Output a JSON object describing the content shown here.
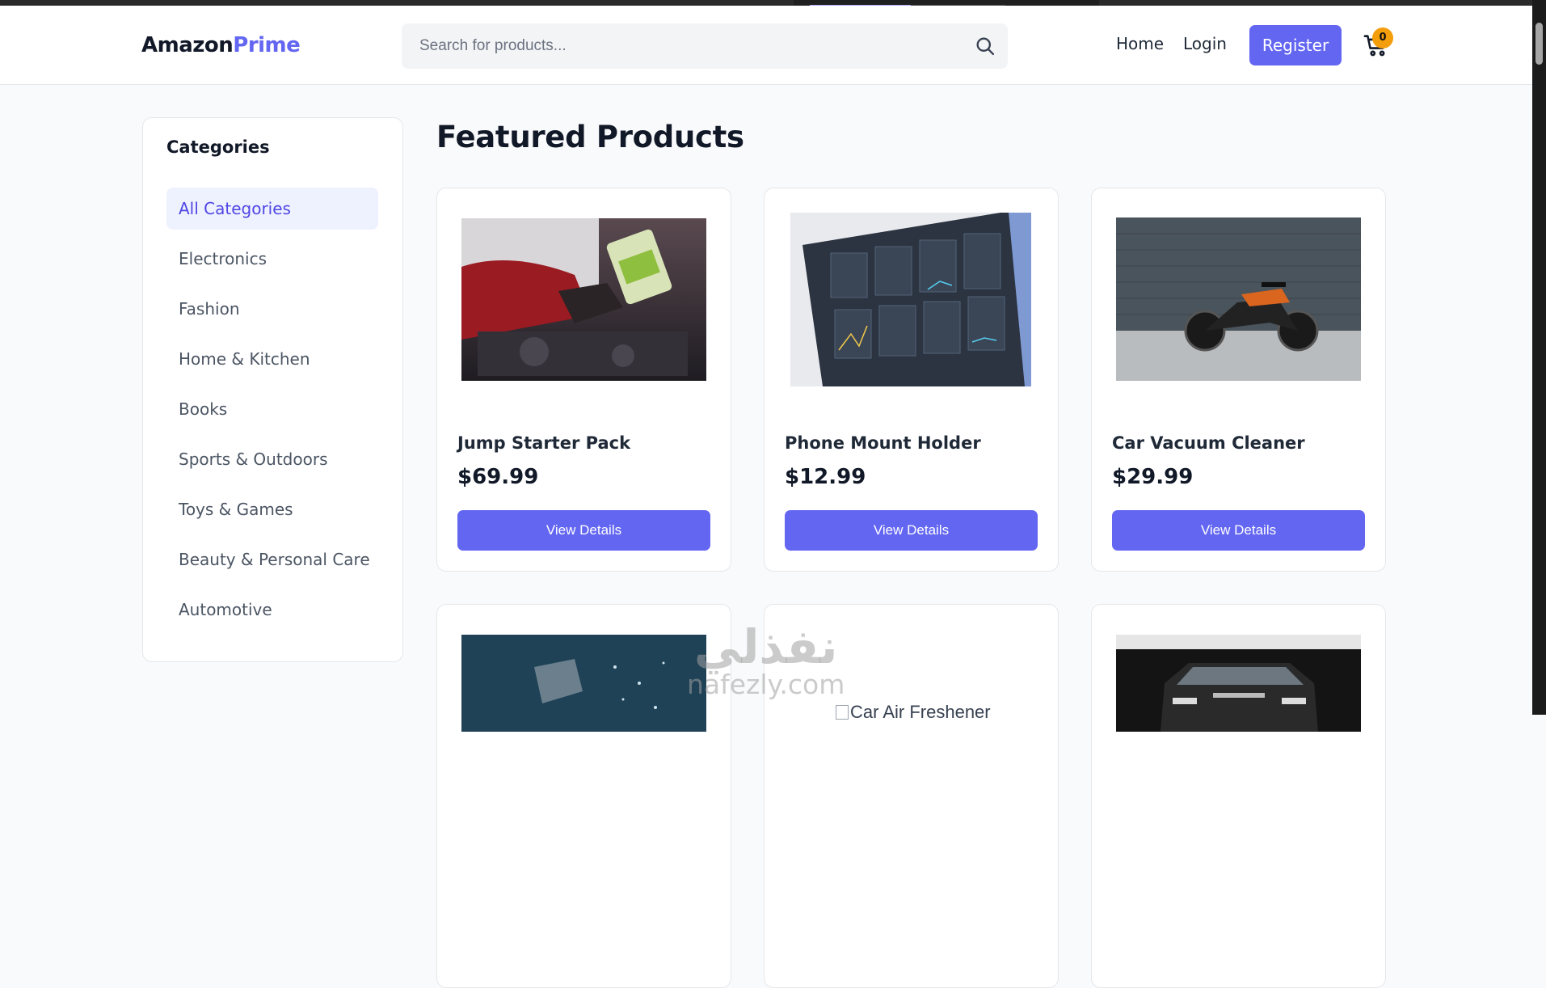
{
  "header": {
    "logo_part1": "Amazon",
    "logo_part2": "Prime",
    "search_placeholder": "Search for products...",
    "nav": {
      "home": "Home",
      "login": "Login",
      "register": "Register"
    },
    "cart_count": "0"
  },
  "sidebar": {
    "title": "Categories",
    "items": [
      {
        "label": "All Categories",
        "active": true
      },
      {
        "label": "Electronics"
      },
      {
        "label": "Fashion"
      },
      {
        "label": "Home & Kitchen"
      },
      {
        "label": "Books"
      },
      {
        "label": "Sports & Outdoors"
      },
      {
        "label": "Toys & Games"
      },
      {
        "label": "Beauty & Personal Care"
      },
      {
        "label": "Automotive"
      }
    ]
  },
  "main": {
    "title": "Featured Products",
    "products": [
      {
        "name": "Jump Starter Pack",
        "price": "$69.99",
        "button": "View Details",
        "image": "car-engine-oil-photo"
      },
      {
        "name": "Phone Mount Holder",
        "price": "$12.99",
        "button": "View Details",
        "image": "dashboard-screen-photo"
      },
      {
        "name": "Car Vacuum Cleaner",
        "price": "$29.99",
        "button": "View Details",
        "image": "motorcycle-photo"
      },
      {
        "name": "",
        "price": "",
        "button": "",
        "image": "mechanic-tools-photo"
      },
      {
        "name": "",
        "price": "",
        "button": "",
        "image": "broken-image",
        "alt": "Car Air Freshener"
      },
      {
        "name": "",
        "price": "",
        "button": "",
        "image": "suv-car-photo"
      }
    ]
  },
  "watermark": {
    "arabic": "نفذلي",
    "latin": "nafezly.com"
  },
  "colors": {
    "accent": "#6366f1",
    "badge": "#f59e0b",
    "background": "#f9fafb"
  }
}
